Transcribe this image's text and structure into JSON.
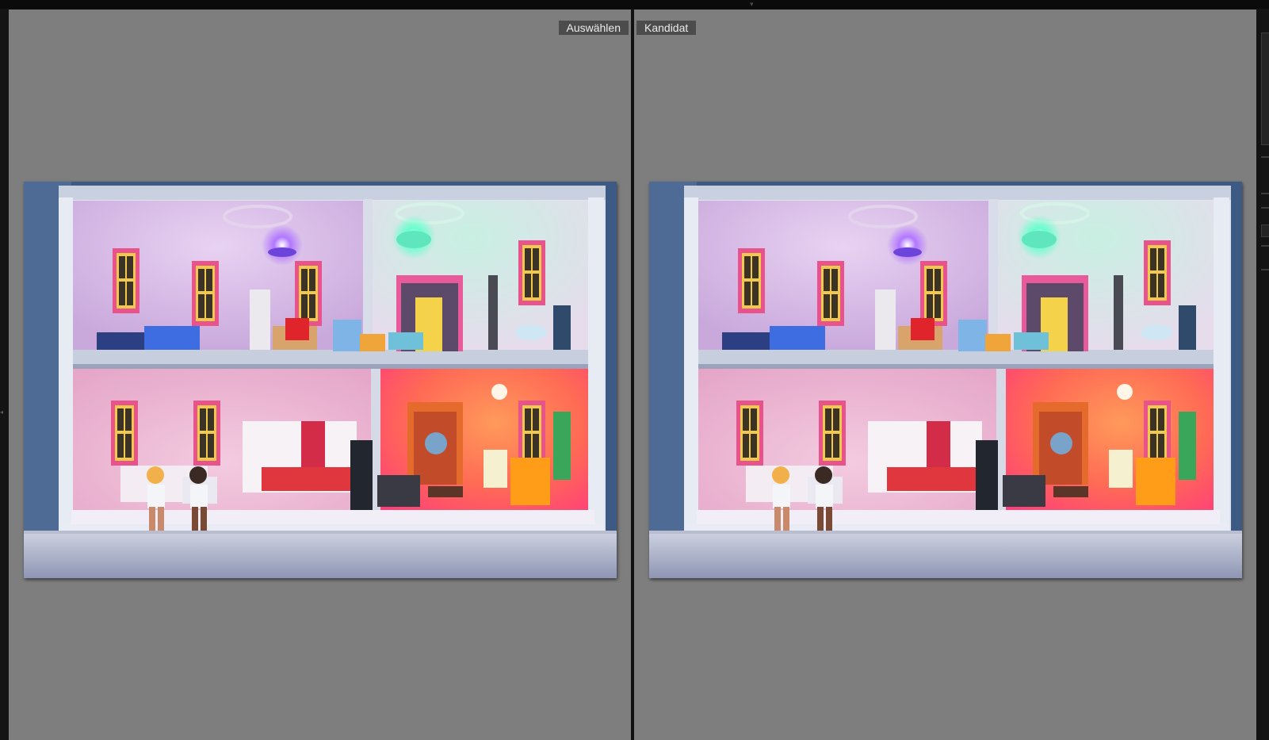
{
  "labels": {
    "select": "Auswählen",
    "candidate": "Kandidat"
  },
  "colors": {
    "background": "#7e7e7e",
    "label_bg": "#4c4c4c",
    "label_text": "#ececec",
    "divider": "#121212"
  },
  "photos": {
    "select": "dollhouse-photo-select",
    "candidate": "dollhouse-photo-candidate"
  }
}
